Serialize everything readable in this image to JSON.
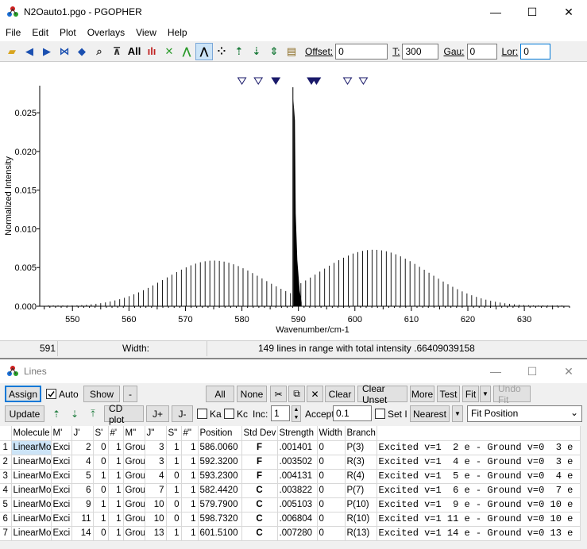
{
  "main_window": {
    "title": "N2Oauto1.pgo - PGOPHER",
    "controls": {
      "minimize": "—",
      "maximize": "☐",
      "close": "✕"
    },
    "menu": [
      "File",
      "Edit",
      "Plot",
      "Overlays",
      "View",
      "Help"
    ],
    "toolbar": {
      "all_label": "All",
      "offset_label": "Offset:",
      "offset_value": "0",
      "t_label": "T:",
      "t_value": "300",
      "gau_label": "Gau:",
      "gau_value": "0",
      "lor_label": "Lor:",
      "lor_value": "0"
    }
  },
  "status": {
    "position": "591",
    "width_label": "Width:",
    "message": "149 lines in range with total intensity .66409039158"
  },
  "chart_data": {
    "type": "line",
    "xlabel": "Wavenumber/cm-1",
    "ylabel": "Normalized Intensity",
    "xlim": [
      544.2,
      638.0
    ],
    "ylim": [
      0,
      0.0285
    ],
    "xticks": [
      550,
      560,
      570,
      580,
      590,
      600,
      610,
      620,
      630
    ],
    "xtick_labels": [
      "550",
      "560",
      "570",
      "580",
      "590",
      "600",
      "610",
      "620",
      "630"
    ],
    "yticks": [
      0.0,
      0.005,
      0.01,
      0.015,
      0.02,
      0.025
    ],
    "ytick_labels": [
      "0.000",
      "0.005",
      "0.010",
      "0.015",
      "0.020",
      "0.025"
    ],
    "series": [
      {
        "branch": "P",
        "x_start": 588.6,
        "x_end": 545.0,
        "spacing": 0.84,
        "peak_x": 575.0,
        "peak_y": 0.0059,
        "sigma": 8.6
      },
      {
        "branch": "R",
        "x_start": 589.6,
        "x_end": 637.0,
        "spacing": 0.84,
        "peak_x": 603.3,
        "peak_y": 0.0073,
        "sigma": 9.6
      },
      {
        "branch": "Q",
        "x_start": 589.1,
        "x_end": 590.0,
        "peak_y": 0.0268
      }
    ],
    "markers": [
      {
        "x": 580.0,
        "filled": false
      },
      {
        "x": 582.9,
        "filled": false
      },
      {
        "x": 586.0,
        "filled": true
      },
      {
        "x": 592.3,
        "filled": true
      },
      {
        "x": 593.2,
        "filled": true
      },
      {
        "x": 598.7,
        "filled": false
      },
      {
        "x": 601.5,
        "filled": false
      }
    ]
  },
  "lines_window": {
    "title": "Lines",
    "controls": {
      "minimize": "—",
      "maximize": "☐",
      "close": "✕"
    },
    "buttons": {
      "assign": "Assign",
      "auto": "Auto",
      "show": "Show",
      "dash": "-",
      "all": "All",
      "none": "None",
      "clear": "Clear",
      "clear_unset": "Clear Unset",
      "more": "More",
      "test": "Test",
      "fit": "Fit",
      "undo_fit": "Undo Fit",
      "update": "Update",
      "cd_plot": "CD plot",
      "j_plus": "J+",
      "j_minus": "J-",
      "ka": "Ka",
      "kc": "Kc",
      "inc_label": "Inc:",
      "inc_value": "1",
      "accept_label": "Accept",
      "accept_value": "0.1",
      "set_i": "Set I",
      "nearest": "Nearest",
      "fit_mode": "Fit Position"
    },
    "columns": [
      "",
      "Molecule",
      "M'",
      "J'",
      "S'",
      "#'",
      "M\"",
      "J\"",
      "S\"",
      "#\"",
      "Position",
      "Std Dev",
      "Strength",
      "Width",
      "Branch",
      ""
    ],
    "rows": [
      {
        "n": "1",
        "mol": "LinearMol",
        "m1": "Exci",
        "j1": "2",
        "s1": "0",
        "h1": "1",
        "m2": "Grou",
        "j2": "3",
        "s2": "1",
        "h2": "1",
        "pos": "586.0060",
        "sd": "F",
        "str": ".001401",
        "w": "0",
        "br": "P(3)",
        "desc": "Excited v=1  2 e - Ground v=0  3 e"
      },
      {
        "n": "2",
        "mol": "LinearMol",
        "m1": "Exci",
        "j1": "4",
        "s1": "0",
        "h1": "1",
        "m2": "Grou",
        "j2": "3",
        "s2": "1",
        "h2": "1",
        "pos": "592.3200",
        "sd": "F",
        "str": ".003502",
        "w": "0",
        "br": "R(3)",
        "desc": "Excited v=1  4 e - Ground v=0  3 e"
      },
      {
        "n": "3",
        "mol": "LinearMol",
        "m1": "Exci",
        "j1": "5",
        "s1": "1",
        "h1": "1",
        "m2": "Grou",
        "j2": "4",
        "s2": "0",
        "h2": "1",
        "pos": "593.2300",
        "sd": "F",
        "str": ".004131",
        "w": "0",
        "br": "R(4)",
        "desc": "Excited v=1  5 e - Ground v=0  4 e"
      },
      {
        "n": "4",
        "mol": "LinearMol",
        "m1": "Exci",
        "j1": "6",
        "s1": "0",
        "h1": "1",
        "m2": "Grou",
        "j2": "7",
        "s2": "1",
        "h2": "1",
        "pos": "582.4420",
        "sd": "C",
        "str": ".003822",
        "w": "0",
        "br": "P(7)",
        "desc": "Excited v=1  6 e - Ground v=0  7 e"
      },
      {
        "n": "5",
        "mol": "LinearMol",
        "m1": "Exci",
        "j1": "9",
        "s1": "1",
        "h1": "1",
        "m2": "Grou",
        "j2": "10",
        "s2": "0",
        "h2": "1",
        "pos": "579.7900",
        "sd": "C",
        "str": ".005103",
        "w": "0",
        "br": "P(10)",
        "desc": "Excited v=1  9 e - Ground v=0 10 e"
      },
      {
        "n": "6",
        "mol": "LinearMol",
        "m1": "Exci",
        "j1": "11",
        "s1": "1",
        "h1": "1",
        "m2": "Grou",
        "j2": "10",
        "s2": "0",
        "h2": "1",
        "pos": "598.7320",
        "sd": "C",
        "str": ".006804",
        "w": "0",
        "br": "R(10)",
        "desc": "Excited v=1 11 e - Ground v=0 10 e"
      },
      {
        "n": "7",
        "mol": "LinearMol",
        "m1": "Exci",
        "j1": "14",
        "s1": "0",
        "h1": "1",
        "m2": "Grou",
        "j2": "13",
        "s2": "1",
        "h2": "1",
        "pos": "601.5100",
        "sd": "C",
        "str": ".007280",
        "w": "0",
        "br": "R(13)",
        "desc": "Excited v=1 14 e - Ground v=0 13 e"
      }
    ]
  }
}
